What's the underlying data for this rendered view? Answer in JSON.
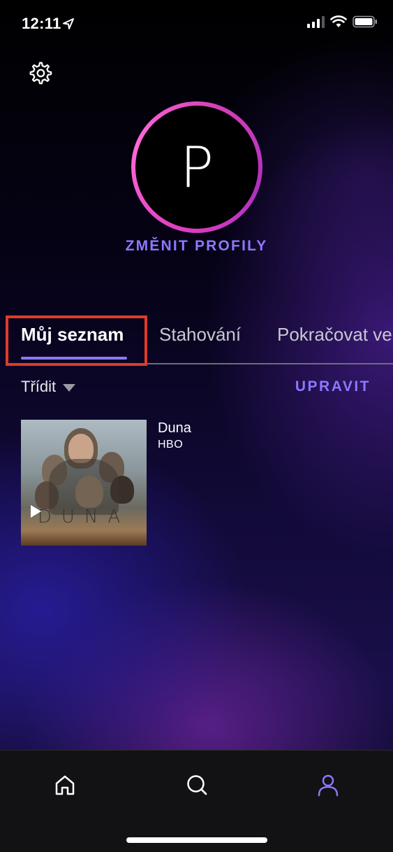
{
  "status_bar": {
    "time": "12:11"
  },
  "profile": {
    "initial": "P",
    "switch_label": "ZMĚNIT PROFILY"
  },
  "tabs": [
    {
      "label": "Můj seznam",
      "active": true
    },
    {
      "label": "Stahování",
      "active": false
    },
    {
      "label": "Pokračovat ve",
      "active": false
    }
  ],
  "toolbar": {
    "sort_label": "Třídit",
    "edit_label": "UPRAVIT"
  },
  "list": [
    {
      "title": "Duna",
      "network": "HBO",
      "poster_text": "DUNA"
    }
  ],
  "nav": {
    "items": [
      "home-icon",
      "search-icon",
      "profile-icon"
    ],
    "active": "profile-icon"
  },
  "colors": {
    "accent": "#8c78ff",
    "ring": "#e040c0",
    "highlight": "#e03a2a"
  }
}
